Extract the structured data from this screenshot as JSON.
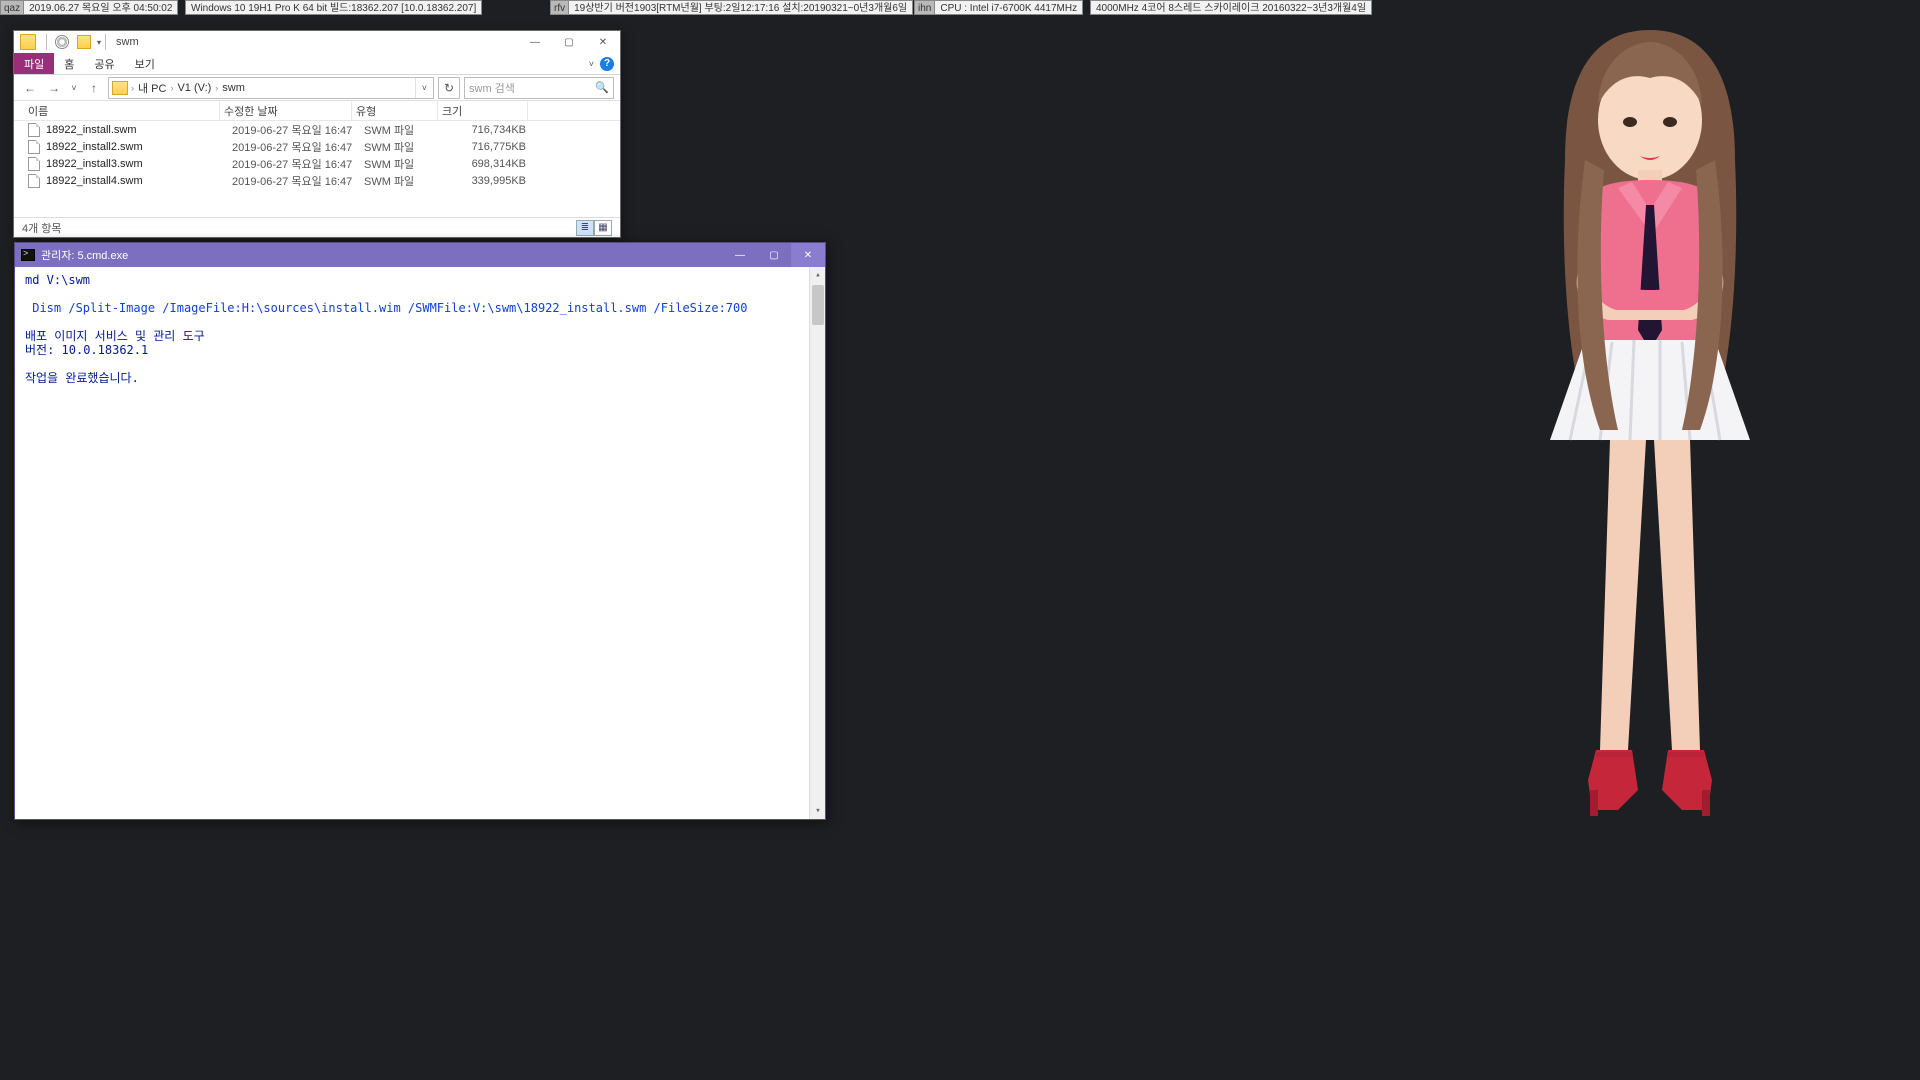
{
  "status": {
    "qaz": {
      "label": "qaz",
      "value": "2019.06.27 목요일 오후 04:50:02"
    },
    "win": {
      "value": "Windows 10 19H1 Pro K 64 bit 빌드:18362.207 [10.0.18362.207]"
    },
    "rfv": {
      "label": "rfv",
      "value": "19상반기 버전1903[RTM년월] 부팅:2일12:17:16 설치:20190321~0년3개월6일"
    },
    "ihn": {
      "label": "ihn",
      "value": "CPU : Intel i7-6700K 4417MHz"
    },
    "last": {
      "value": "4000MHz 4코어 8스레드 스카이레이크 20160322~3년3개월4일"
    }
  },
  "explorer": {
    "title": "swm",
    "tabs": {
      "file": "파일",
      "home": "홈",
      "share": "공유",
      "view": "보기"
    },
    "help": "?",
    "nav": {
      "back": "←",
      "fwd": "→",
      "hist": "˅",
      "up": "↑"
    },
    "path": {
      "root": "내 PC",
      "drive": "V1 (V:)",
      "folder": "swm"
    },
    "refresh": "↻",
    "search": {
      "placeholder": "swm 검색",
      "icon": "🔍"
    },
    "cols": {
      "name": "이름",
      "date": "수정한 날짜",
      "type": "유형",
      "size": "크기"
    },
    "files": [
      {
        "name": "18922_install.swm",
        "date": "2019-06-27 목요일 16:47",
        "type": "SWM 파일",
        "size": "716,734KB"
      },
      {
        "name": "18922_install2.swm",
        "date": "2019-06-27 목요일 16:47",
        "type": "SWM 파일",
        "size": "716,775KB"
      },
      {
        "name": "18922_install3.swm",
        "date": "2019-06-27 목요일 16:47",
        "type": "SWM 파일",
        "size": "698,314KB"
      },
      {
        "name": "18922_install4.swm",
        "date": "2019-06-27 목요일 16:47",
        "type": "SWM 파일",
        "size": "339,995KB"
      }
    ],
    "status": "4개 항목",
    "win_btns": {
      "min": "—",
      "max": "▢",
      "close": "✕"
    }
  },
  "cmd": {
    "title": "관리자: 5.cmd.exe",
    "btns": {
      "min": "—",
      "max": "▢",
      "close": "✕"
    },
    "lines": {
      "l1": "md V:\\swm",
      "l2": " Dism /Split-Image /ImageFile:H:\\sources\\install.wim /SWMFile:V:\\swm\\18922_install.swm /FileSize:700",
      "l3": "배포 이미지 서비스 및 관리 도구",
      "l4": "버전: 10.0.18362.1",
      "l5": "작업을 완료했습니다."
    }
  }
}
